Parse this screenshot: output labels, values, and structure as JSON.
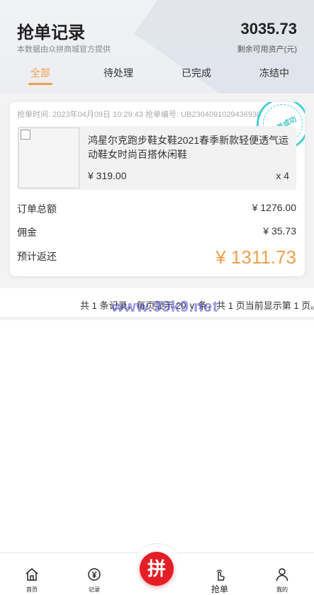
{
  "header": {
    "title": "抢单记录",
    "subtitle": "本数据由众拼商城官方提供",
    "amount": "3035.73",
    "amount_label": "剩余可用资产(元)"
  },
  "tabs": [
    {
      "label": "全部",
      "active": true
    },
    {
      "label": "待处理",
      "active": false
    },
    {
      "label": "已完成",
      "active": false
    },
    {
      "label": "冻结中",
      "active": false
    }
  ],
  "order": {
    "meta": "抢单时间: 2023年04月09日 10:29:43 抢单编号: UB2304091029436930",
    "stamp": "抢单成功",
    "product_name": "鸿星尔克跑步鞋女鞋2021春季新款轻便透气运动鞋女时尚百搭休闲鞋",
    "price": "¥ 319.00",
    "quantity": "x 4",
    "total_label": "订单总额",
    "total_value": "¥ 1276.00",
    "commission_label": "佣金",
    "commission_value": "¥ 35.73",
    "return_label": "预计返还",
    "return_value": "¥ 1311.73"
  },
  "pager": {
    "text": "共 1 条记录，每页显示 20   ∨  条，共 1 页当前显示第 1 页。"
  },
  "watermark": "www.99k9.net",
  "bottom_nav": {
    "home": "首页",
    "records": "记录",
    "center": "拼",
    "grab": "抢单",
    "mine": "我的"
  },
  "colors": {
    "accent": "#f0a04b",
    "brand_red": "#e41e26",
    "stamp": "#34c9cf"
  }
}
